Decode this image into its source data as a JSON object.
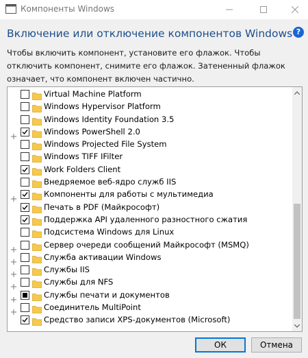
{
  "window": {
    "title": "Компоненты Windows",
    "icons": [
      "app-icon",
      "minimize-icon",
      "maximize-icon",
      "close-icon"
    ]
  },
  "header": {
    "heading": "Включение или отключение компонентов Windows",
    "help_icon": "?",
    "description": "Чтобы включить компонент, установите его флажок. Чтобы отключить компонент, снимите его флажок. Затененный флажок означает, что компонент включен частично."
  },
  "features": [
    {
      "label": "Virtual Machine Platform",
      "state": "unchecked",
      "expandable": false
    },
    {
      "label": "Windows Hypervisor Platform",
      "state": "unchecked",
      "expandable": false
    },
    {
      "label": "Windows Identity Foundation 3.5",
      "state": "unchecked",
      "expandable": false
    },
    {
      "label": "Windows PowerShell 2.0",
      "state": "checked",
      "expandable": true
    },
    {
      "label": "Windows Projected File System",
      "state": "unchecked",
      "expandable": false
    },
    {
      "label": "Windows TIFF IFilter",
      "state": "unchecked",
      "expandable": false
    },
    {
      "label": "Work Folders Client",
      "state": "checked",
      "expandable": false
    },
    {
      "label": "Внедряемое веб-ядро служб IIS",
      "state": "unchecked",
      "expandable": false
    },
    {
      "label": "Компоненты для работы с мультимедиа",
      "state": "checked",
      "expandable": true
    },
    {
      "label": "Печать в PDF (Майкрософт)",
      "state": "checked",
      "expandable": false
    },
    {
      "label": "Поддержка API удаленного разностного сжатия",
      "state": "checked",
      "expandable": false
    },
    {
      "label": "Подсистема Windows для Linux",
      "state": "unchecked",
      "expandable": false
    },
    {
      "label": "Сервер очереди сообщений Майкрософт (MSMQ)",
      "state": "unchecked",
      "expandable": true
    },
    {
      "label": "Служба активации Windows",
      "state": "unchecked",
      "expandable": true
    },
    {
      "label": "Службы IIS",
      "state": "unchecked",
      "expandable": true
    },
    {
      "label": "Службы для NFS",
      "state": "unchecked",
      "expandable": true
    },
    {
      "label": "Службы печати и документов",
      "state": "partial",
      "expandable": true
    },
    {
      "label": "Соединитель MultiPoint",
      "state": "unchecked",
      "expandable": true
    },
    {
      "label": "Средство записи XPS-документов (Microsoft)",
      "state": "checked",
      "expandable": false
    }
  ],
  "buttons": {
    "ok": "ОК",
    "cancel": "Отмена"
  },
  "colors": {
    "heading": "#1c4e8c",
    "help": "#1a66d2",
    "folder": "#f6c94e",
    "focus": "#0078d7"
  }
}
